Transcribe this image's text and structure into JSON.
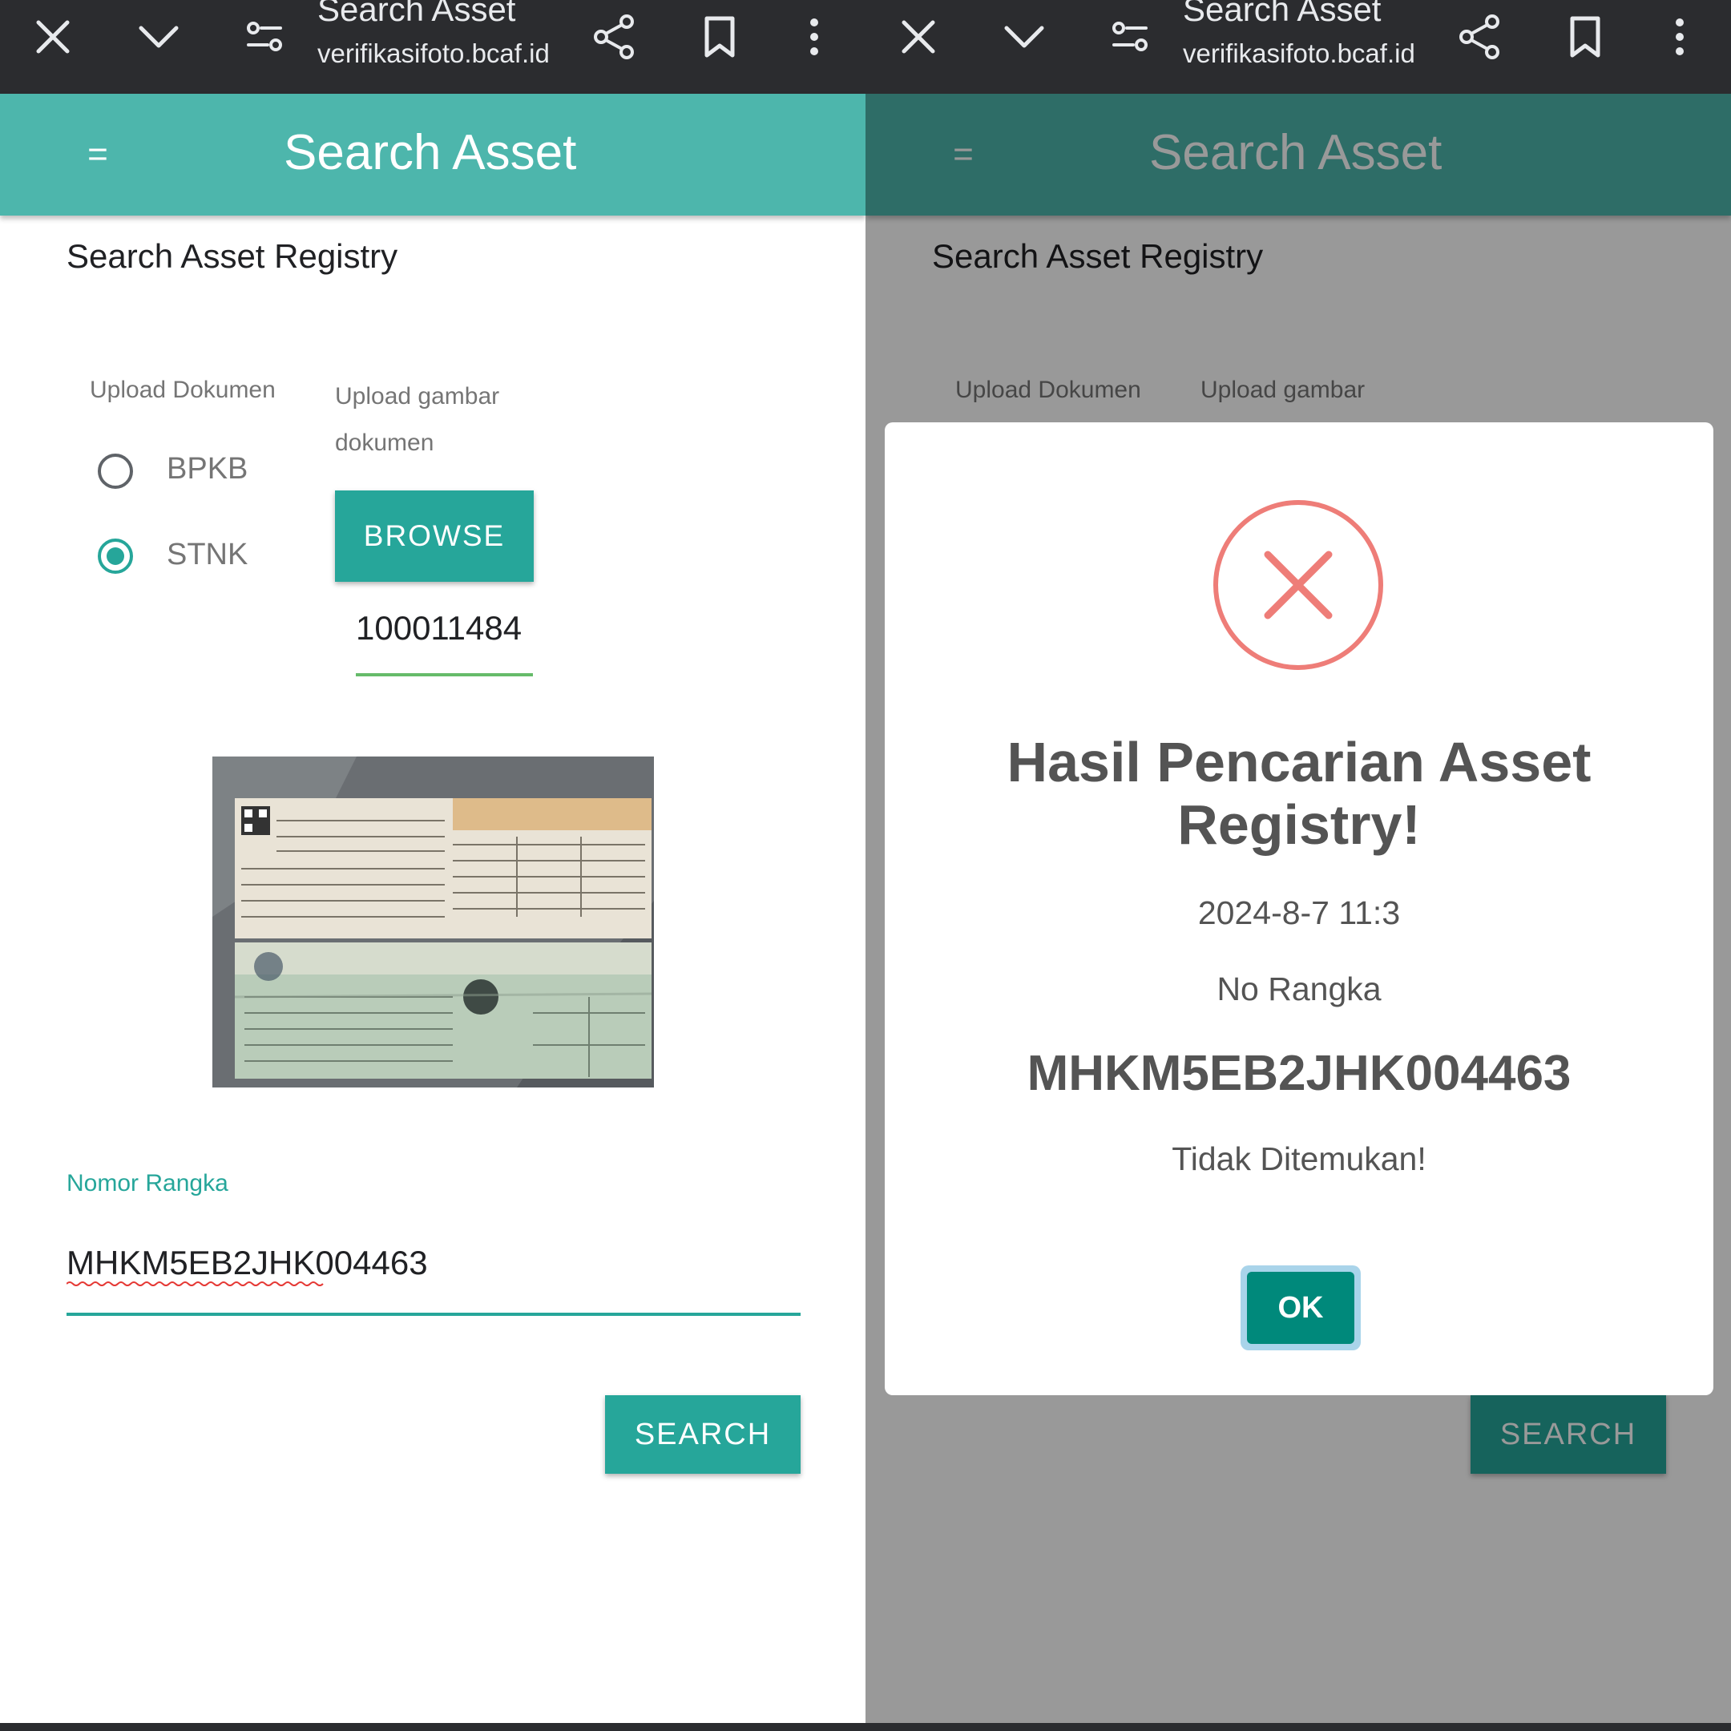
{
  "browser": {
    "page_title": "Search Asset",
    "url": "verifikasifoto.bcaf.id",
    "icons": [
      "close-icon",
      "chevron-down-icon",
      "tune-icon",
      "share-icon",
      "bookmark-icon",
      "more-vert-icon"
    ]
  },
  "app": {
    "title": "Search Asset",
    "menu_glyph": "=",
    "colors": {
      "header": "#4db6ac",
      "accent": "#26a69a",
      "error": "#ee7d78",
      "ok_button": "#00897b"
    }
  },
  "form": {
    "heading": "Search Asset Registry",
    "doc_type_label": "Upload Dokumen",
    "upload_label": "Upload gambar dokumen",
    "upload_label_truncated": "Upload gambar",
    "options": [
      {
        "label": "BPKB",
        "selected": false
      },
      {
        "label": "STNK",
        "selected": true
      }
    ],
    "browse_label": "BROWSE",
    "file_name": "100011484",
    "field_label": "Nomor Rangka",
    "field_value": "MHKM5EB2JHK004463",
    "search_label": "SEARCH",
    "document_photo": "document-photo-icon"
  },
  "dialog": {
    "icon": "error-x-icon",
    "title": "Hasil Pencarian Asset Registry!",
    "date": "2024-8-7 11:3",
    "label": "No Rangka",
    "value": "MHKM5EB2JHK004463",
    "status": "Tidak Ditemukan!",
    "ok_label": "OK"
  }
}
